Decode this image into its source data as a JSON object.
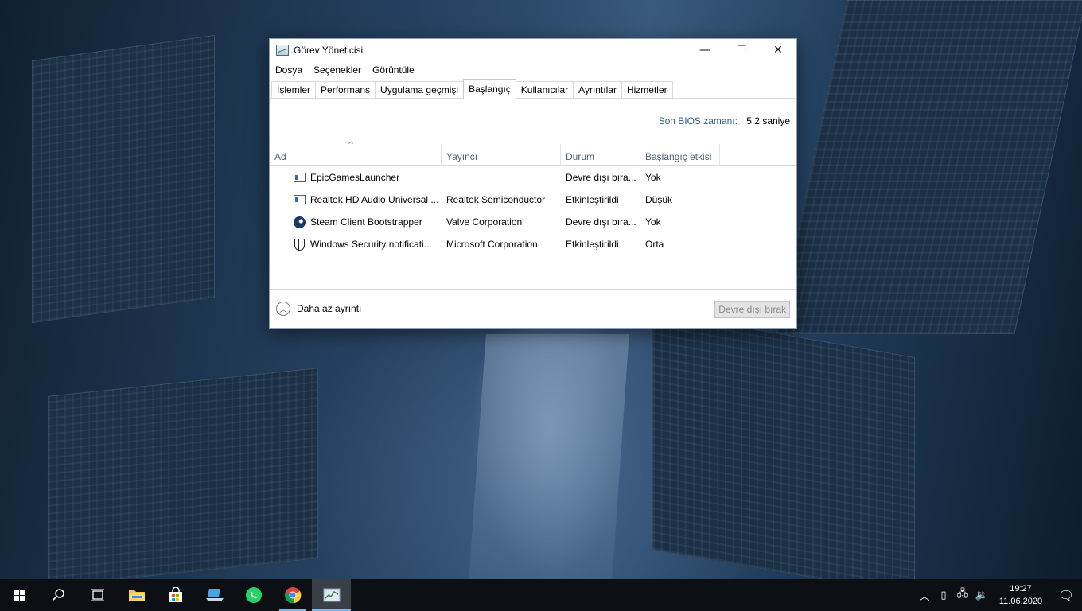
{
  "window": {
    "title": "Görev Yöneticisi",
    "controls": {
      "minimize": "—",
      "maximize": "☐",
      "close": "✕"
    }
  },
  "menu": [
    "Dosya",
    "Seçenekler",
    "Görüntüle"
  ],
  "tabs": [
    "İşlemler",
    "Performans",
    "Uygulama geçmişi",
    "Başlangıç",
    "Kullanıcılar",
    "Ayrıntılar",
    "Hizmetler"
  ],
  "active_tab": "Başlangıç",
  "bios": {
    "label": "Son BIOS zamanı:",
    "value": "5.2 saniye"
  },
  "columns": {
    "name": "Ad",
    "publisher": "Yayıncı",
    "status": "Durum",
    "impact": "Başlangıç etkisi",
    "sort_indicator": "^"
  },
  "rows": [
    {
      "icon": "app-window-icon",
      "name": "EpicGamesLauncher",
      "publisher": "",
      "status": "Devre dışı bıra...",
      "impact": "Yok"
    },
    {
      "icon": "app-window-icon",
      "name": "Realtek HD Audio Universal ...",
      "publisher": "Realtek Semiconductor",
      "status": "Etkinleştirildi",
      "impact": "Düşük"
    },
    {
      "icon": "steam-icon",
      "name": "Steam Client Bootstrapper",
      "publisher": "Valve Corporation",
      "status": "Devre dışı bıra...",
      "impact": "Yok"
    },
    {
      "icon": "shield-icon",
      "name": "Windows Security notificati...",
      "publisher": "Microsoft Corporation",
      "status": "Etkinleştirildi",
      "impact": "Orta"
    }
  ],
  "footer": {
    "less_details": "Daha az ayrıntı",
    "disable_button": "Devre dışı bırak"
  },
  "taskbar": {
    "apps": [
      "start-icon",
      "search-icon",
      "task-view-icon",
      "file-explorer-icon",
      "microsoft-store-icon",
      "laptop-icon",
      "whatsapp-icon",
      "chrome-icon",
      "task-manager-icon"
    ],
    "clock_time": "19:27",
    "clock_date": "11.06.2020"
  },
  "colors": {
    "accent": "#76b9ed",
    "header_text": "#4c607a",
    "bios_label": "#2d5f8f"
  }
}
